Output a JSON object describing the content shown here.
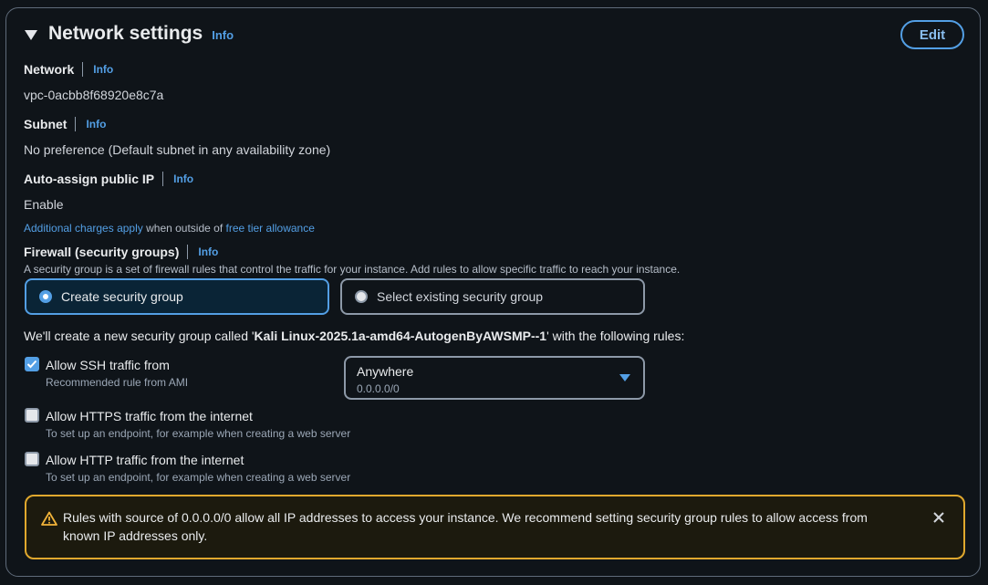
{
  "header": {
    "title": "Network settings",
    "info": "Info",
    "edit_label": "Edit"
  },
  "network": {
    "label": "Network",
    "info": "Info",
    "value": "vpc-0acbb8f68920e8c7a"
  },
  "subnet": {
    "label": "Subnet",
    "info": "Info",
    "value": "No preference (Default subnet in any availability zone)"
  },
  "public_ip": {
    "label": "Auto-assign public IP",
    "info": "Info",
    "value": "Enable",
    "note_link1": "Additional charges apply",
    "note_mid": " when outside of ",
    "note_link2": "free tier allowance"
  },
  "firewall": {
    "label": "Firewall (security groups)",
    "info": "Info",
    "description": "A security group is a set of firewall rules that control the traffic for your instance. Add rules to allow specific traffic to reach your instance.",
    "option_create": "Create security group",
    "option_existing": "Select existing security group",
    "create_prefix": "We'll create a new security group called '",
    "group_name": "Kali Linux-2025.1a-amd64-AutogenByAWSMP--1",
    "create_suffix": "' with the following rules:"
  },
  "rules": {
    "ssh": {
      "label": "Allow SSH traffic from",
      "sub": "Recommended rule from AMI",
      "checked": true
    },
    "ssh_source": {
      "value": "Anywhere",
      "sub": "0.0.0.0/0"
    },
    "https": {
      "label": "Allow HTTPS traffic from the internet",
      "sub": "To set up an endpoint, for example when creating a web server",
      "checked": false
    },
    "http": {
      "label": "Allow HTTP traffic from the internet",
      "sub": "To set up an endpoint, for example when creating a web server",
      "checked": false
    }
  },
  "warning": {
    "text": "Rules with source of 0.0.0.0/0 allow all IP addresses to access your instance. We recommend setting security group rules to allow access from known IP addresses only."
  },
  "colors": {
    "accent": "#539fe5",
    "warning": "#e0a82e",
    "background": "#0f1419"
  }
}
